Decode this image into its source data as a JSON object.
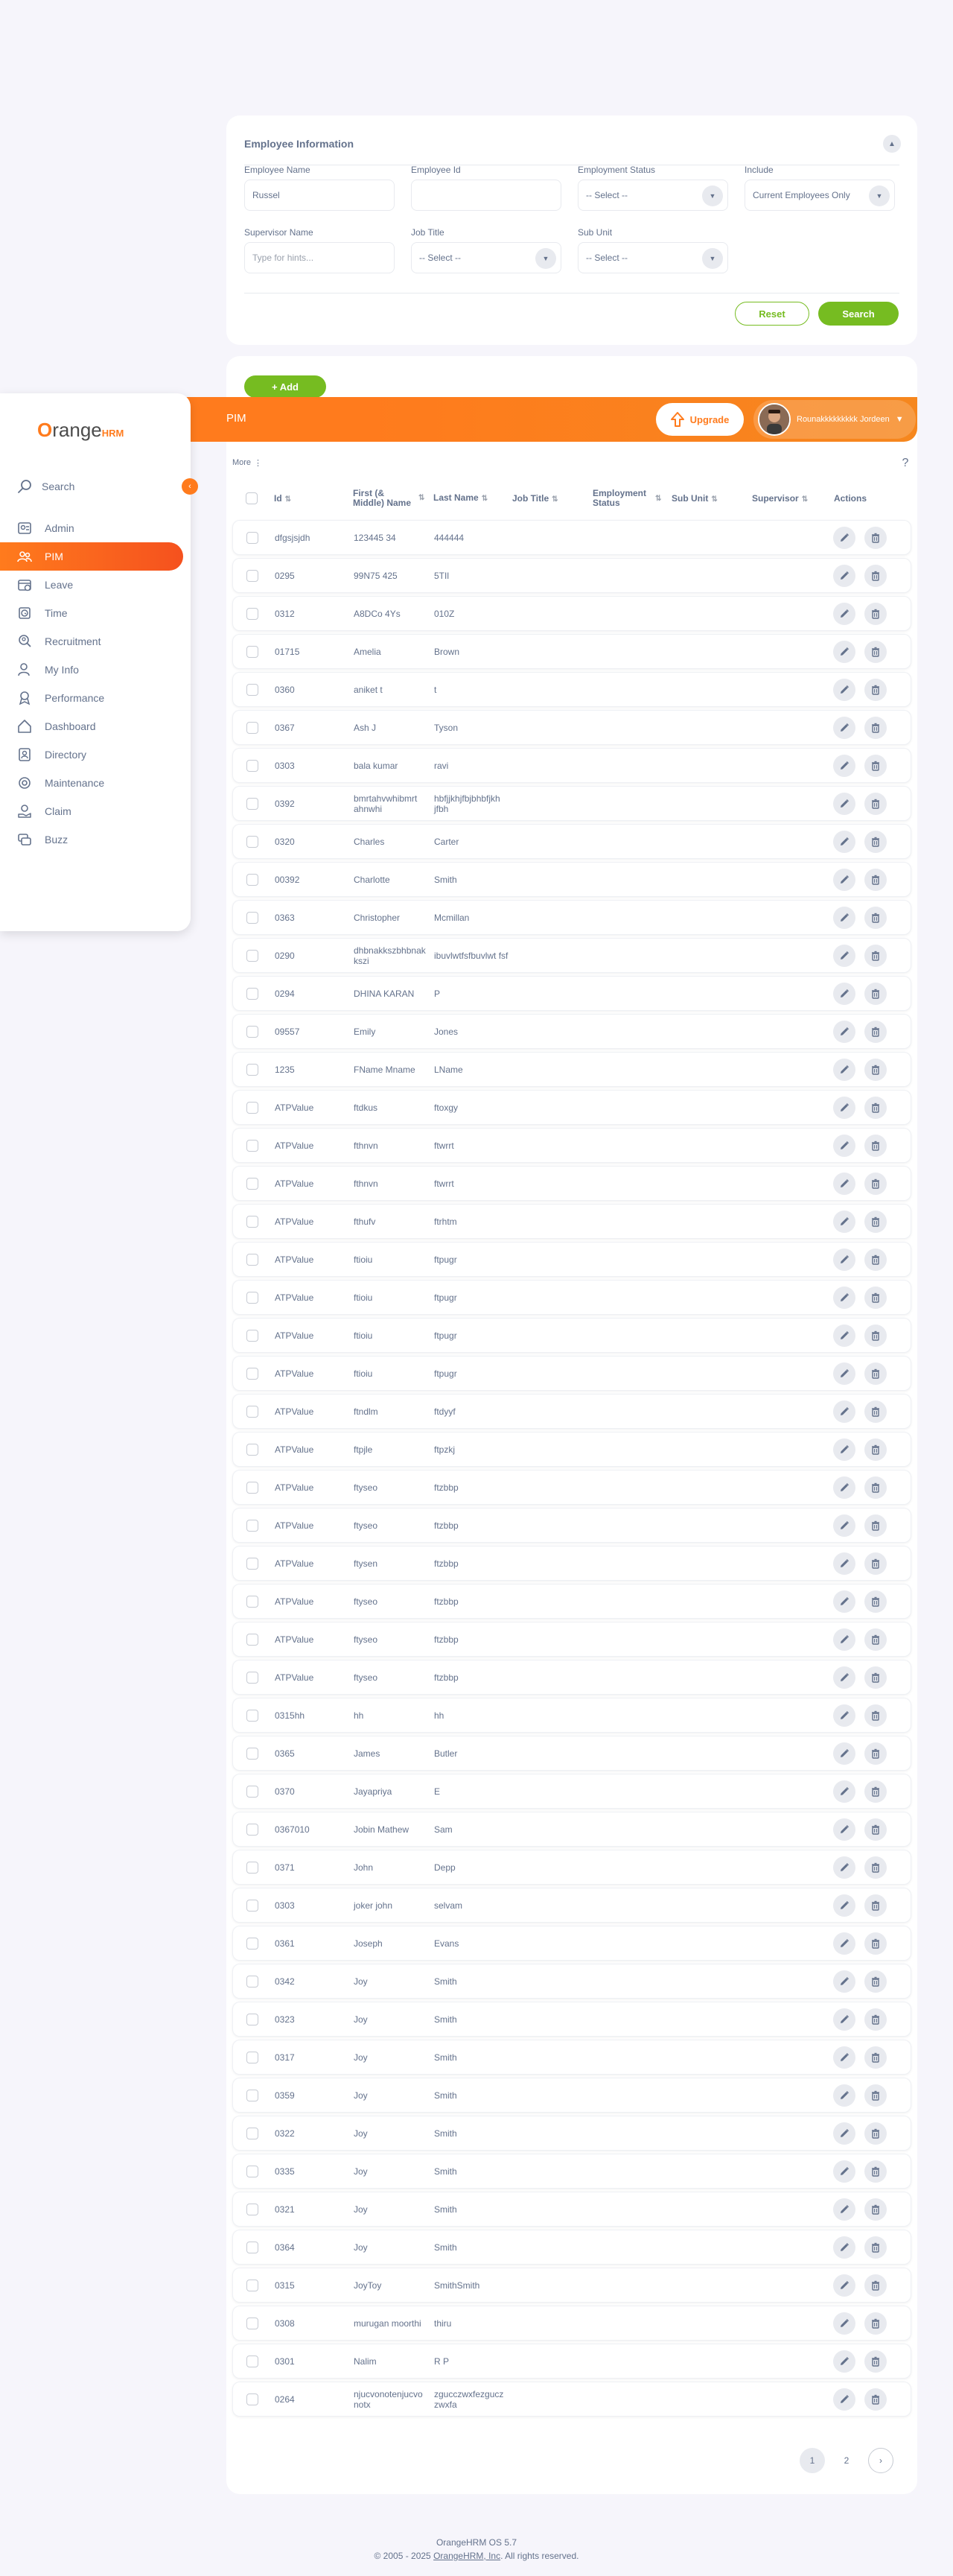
{
  "filter": {
    "title": "Employee Information",
    "fields": [
      {
        "label": "Employee Name",
        "value": "Russel",
        "placeholder": ""
      },
      {
        "label": "Employee Id",
        "value": "",
        "placeholder": ""
      },
      {
        "label": "Employment Status",
        "value": "-- Select --"
      },
      {
        "label": "Include",
        "value": "Current Employees Only"
      },
      {
        "label": "Supervisor Name",
        "value": "",
        "placeholder": "Type for hints..."
      },
      {
        "label": "Job Title",
        "value": "-- Select --"
      },
      {
        "label": "Sub Unit",
        "value": "-- Select --"
      }
    ],
    "reset_label": "Reset",
    "search_label": "Search"
  },
  "results": {
    "add_label": "+ Add"
  },
  "header": {
    "title": "PIM",
    "upgrade_label": "Upgrade",
    "user_name": "Rounakkkkkkkkk Jordeen"
  },
  "subbar": {
    "more_label": "More",
    "help_label": "?"
  },
  "sidebar": {
    "logo_main": "range",
    "logo_o": "O",
    "logo_hrm": "HRM",
    "search_label": "Search",
    "items": [
      {
        "label": "Admin",
        "icon": "admin-icon"
      },
      {
        "label": "PIM",
        "icon": "pim-icon",
        "active": true
      },
      {
        "label": "Leave",
        "icon": "leave-icon"
      },
      {
        "label": "Time",
        "icon": "time-icon"
      },
      {
        "label": "Recruitment",
        "icon": "recruitment-icon"
      },
      {
        "label": "My Info",
        "icon": "my-info-icon"
      },
      {
        "label": "Performance",
        "icon": "performance-icon"
      },
      {
        "label": "Dashboard",
        "icon": "dashboard-icon"
      },
      {
        "label": "Directory",
        "icon": "directory-icon"
      },
      {
        "label": "Maintenance",
        "icon": "maintenance-icon"
      },
      {
        "label": "Claim",
        "icon": "claim-icon"
      },
      {
        "label": "Buzz",
        "icon": "buzz-icon"
      }
    ]
  },
  "table": {
    "columns": [
      "Id",
      "First (& Middle) Name",
      "Last Name",
      "Job Title",
      "Employment Status",
      "Sub Unit",
      "Supervisor",
      "Actions"
    ],
    "rows": [
      [
        "dfgsjsjdh",
        "123445 34",
        "444444"
      ],
      [
        "0295",
        "99N75 425",
        "5TIl"
      ],
      [
        "0312",
        "A8DCo 4Ys",
        "010Z"
      ],
      [
        "01715",
        "Amelia",
        "Brown"
      ],
      [
        "0360",
        "aniket t",
        "t"
      ],
      [
        "0367",
        "Ash J",
        "Tyson"
      ],
      [
        "0303",
        "bala kumar",
        "ravi"
      ],
      [
        "0392",
        "bmrtahvwhibmrt ahnwhi",
        "hbfjjkhjfbjbhbfjkh jfbh"
      ],
      [
        "0320",
        "Charles",
        "Carter"
      ],
      [
        "00392",
        "Charlotte",
        "Smith"
      ],
      [
        "0363",
        "Christopher",
        "Mcmillan"
      ],
      [
        "0290",
        "dhbnakkszbhbnak kszi",
        "ibuvlwtfsfbuvlwt fsf"
      ],
      [
        "0294",
        "DHINA KARAN",
        "P"
      ],
      [
        "09557",
        "Emily",
        "Jones"
      ],
      [
        "1235",
        "FName Mname",
        "LName"
      ],
      [
        "ATPValue",
        "ftdkus",
        "ftoxgy"
      ],
      [
        "ATPValue",
        "fthnvn",
        "ftwrrt"
      ],
      [
        "ATPValue",
        "fthnvn",
        "ftwrrt"
      ],
      [
        "ATPValue",
        "fthufv",
        "ftrhtm"
      ],
      [
        "ATPValue",
        "ftioiu",
        "ftpugr"
      ],
      [
        "ATPValue",
        "ftioiu",
        "ftpugr"
      ],
      [
        "ATPValue",
        "ftioiu",
        "ftpugr"
      ],
      [
        "ATPValue",
        "ftioiu",
        "ftpugr"
      ],
      [
        "ATPValue",
        "ftndlm",
        "ftdyyf"
      ],
      [
        "ATPValue",
        "ftpjle",
        "ftpzkj"
      ],
      [
        "ATPValue",
        "ftyseo",
        "ftzbbp"
      ],
      [
        "ATPValue",
        "ftyseo",
        "ftzbbp"
      ],
      [
        "ATPValue",
        "ftysen",
        "ftzbbp"
      ],
      [
        "ATPValue",
        "ftyseo",
        "ftzbbp"
      ],
      [
        "ATPValue",
        "ftyseo",
        "ftzbbp"
      ],
      [
        "ATPValue",
        "ftyseo",
        "ftzbbp"
      ],
      [
        "0315hh",
        "hh",
        "hh"
      ],
      [
        "0365",
        "James",
        "Butler"
      ],
      [
        "0370",
        "Jayapriya",
        "E"
      ],
      [
        "0367010",
        "Jobin Mathew",
        "Sam"
      ],
      [
        "0371",
        "John",
        "Depp"
      ],
      [
        "0303",
        "joker john",
        "selvam"
      ],
      [
        "0361",
        "Joseph",
        "Evans"
      ],
      [
        "0342",
        "Joy",
        "Smith"
      ],
      [
        "0323",
        "Joy",
        "Smith"
      ],
      [
        "0317",
        "Joy",
        "Smith"
      ],
      [
        "0359",
        "Joy",
        "Smith"
      ],
      [
        "0322",
        "Joy",
        "Smith"
      ],
      [
        "0335",
        "Joy",
        "Smith"
      ],
      [
        "0321",
        "Joy",
        "Smith"
      ],
      [
        "0364",
        "Joy",
        "Smith"
      ],
      [
        "0315",
        "JoyToy",
        "SmithSmith"
      ],
      [
        "0308",
        "murugan moorthi",
        "thiru"
      ],
      [
        "0301",
        "Nalim",
        "R P"
      ],
      [
        "0264",
        "njucvonotenjucvo notx",
        "zgucczwxfezgucz zwxfa"
      ]
    ]
  },
  "pagination": {
    "pages": [
      "1",
      "2"
    ],
    "next": "›"
  },
  "footer": {
    "version": "OrangeHRM OS 5.7",
    "copyright_pre": "© 2005 - 2025 ",
    "copyright_link": "OrangeHRM, Inc",
    "copyright_post": ". All rights reserved."
  }
}
